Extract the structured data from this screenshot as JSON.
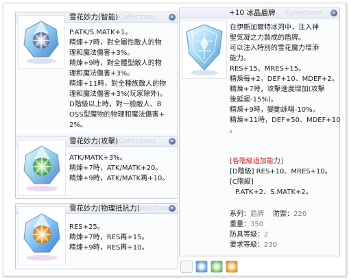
{
  "watermark": "Collections",
  "windows": {
    "intelligence": {
      "title": "雪花妙力(智能)",
      "lines": [
        "P.ATK/S.MATK+1。",
        "精煉+7時，對全屬性敵人的物",
        "理和魔法傷害+3%。",
        "精煉+9時，對全體型敵人的物",
        "理和魔法傷害+3%。",
        "精煉+11時，對全種族敵人的物",
        "理和魔法傷害+3%(玩家除外)。",
        "D階級以上時，對一般敵人、B",
        "OSS型魔物的物理和魔法傷害+",
        "2%。"
      ]
    },
    "attack": {
      "title": "雪花妙力(攻擊)",
      "lines": [
        "ATK/MATK+3%。",
        "精煉+7時，ATK/MATK+20。",
        "精煉+9時，ATK/MATK再+10。"
      ]
    },
    "resist": {
      "title": "雪花妙力(物理抵抗力)",
      "lines": [
        "RES+25。",
        "精煉+7時，RES再+15。",
        "精煉+9時，RES再+10。"
      ]
    },
    "shield": {
      "title": "+10 冰晶盾牌",
      "desc_lines": [
        "在伊斯加爾特冰河中，注入神",
        "聖気凝之力製成的盾牌。",
        "可以注入特別的雪花魔力增添",
        "能力。",
        "RES+15、MRES+15。",
        "精煉每+2，DEF+10、MDEF+2。",
        "精煉+7時，攻擊速度增加(攻擊",
        "後延遲-15%)。",
        "精煉+9時，變動詠唱-10%。",
        "精煉+11時，DEF+50、MDEF+10",
        "。"
      ],
      "grade_header": "[各階級追加能力]",
      "grade_lines": [
        "[D階級] RES+10、MRES+10。",
        "[C階級]",
        "P.ATK+2、S.MATK+2。"
      ],
      "stats": {
        "type_label": "系列：",
        "type_value": "盾牌",
        "defense_label": "防禦：",
        "defense_value": "220",
        "weight_label": "重量：",
        "weight_value": "350",
        "level_label": "防具等級：",
        "level_value": "2",
        "req_label": "要求等級：",
        "req_value": "230"
      }
    }
  },
  "icons": {
    "gem_intelligence": "blue-snowflake-gem-icon",
    "gem_attack": "green-snowflake-gem-icon",
    "gem_resist": "orange-snowflake-gem-icon",
    "shield": "ice-crystal-shield-icon"
  },
  "colors": {
    "accent_red": "#d42020",
    "window_border": "#c4cad6",
    "ice_blue": "#7fc3ec"
  }
}
